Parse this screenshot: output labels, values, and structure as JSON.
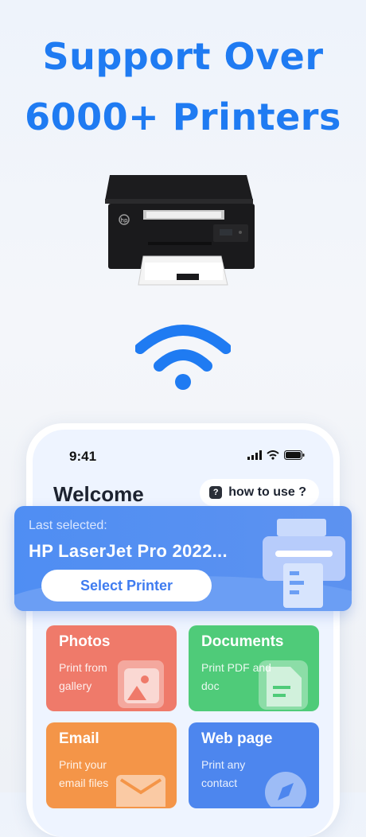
{
  "headline": {
    "line1": "Support Over",
    "line2": "6000+ Printers"
  },
  "printer_brand": "hp",
  "phone": {
    "status": {
      "time": "9:41"
    },
    "welcome": "Welcome",
    "how_to_use": "how to use ?",
    "last_selected": {
      "caption": "Last selected:",
      "printer_name": "HP LaserJet Pro 2022...",
      "button_label": "Select Printer"
    },
    "tiles": [
      {
        "title": "Photos",
        "desc": "Print from gallery",
        "color": "#ef7a6a",
        "icon": "image-icon"
      },
      {
        "title": "Documents",
        "desc": "Print PDF and doc",
        "color": "#4fcb79",
        "icon": "document-icon"
      },
      {
        "title": "Email",
        "desc": "Print your email files",
        "color": "#f49548",
        "icon": "envelope-icon"
      },
      {
        "title": "Web page",
        "desc": "Print any contact",
        "color": "#4d86ee",
        "icon": "compass-icon"
      }
    ]
  },
  "colors": {
    "accent": "#1f7bf2",
    "card_blue": "#4f8ef3"
  }
}
